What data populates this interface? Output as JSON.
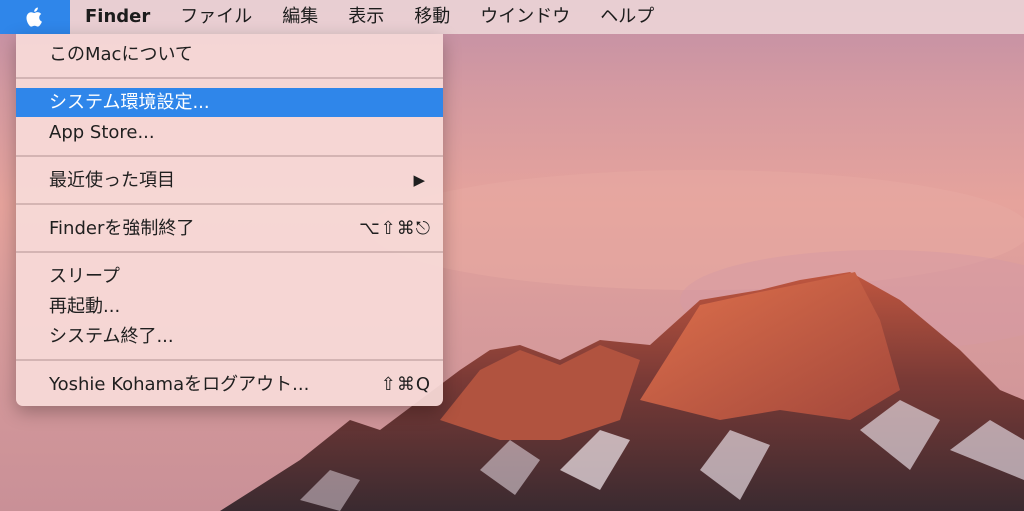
{
  "menubar": {
    "apple_icon": "apple-logo-icon",
    "app_name": "Finder",
    "menus": [
      "ファイル",
      "編集",
      "表示",
      "移動",
      "ウインドウ",
      "ヘルプ"
    ]
  },
  "apple_menu": {
    "about": "このMacについて",
    "system_prefs": "システム環境設定...",
    "app_store": "App Store...",
    "recent_items": "最近使った項目",
    "recent_arrow": "▶",
    "force_quit": "Finderを強制終了",
    "force_quit_shortcut": "⌥⇧⌘⎋",
    "sleep": "スリープ",
    "restart": "再起動...",
    "shutdown": "システム終了...",
    "logout": "Yoshie Kohamaをログアウト...",
    "logout_shortcut": "⇧⌘Q"
  },
  "colors": {
    "highlight": "#2f86ea",
    "menu_bg": "#f8dad8"
  }
}
